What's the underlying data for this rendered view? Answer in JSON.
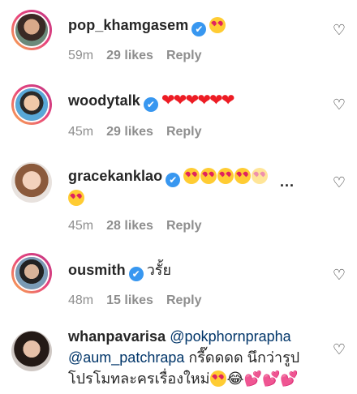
{
  "comments": [
    {
      "username": "pop_khamgasem",
      "verified_icon": "✔",
      "text": "",
      "emoji": "heart-eyes",
      "time": "59m",
      "likes": "29 likes",
      "reply": "Reply"
    },
    {
      "username": "woodytalk",
      "verified_icon": "✔",
      "hearts": "❤❤❤❤❤❤",
      "time": "45m",
      "likes": "29 likes",
      "reply": "Reply"
    },
    {
      "username": "gracekanklao",
      "verified_icon": "✔",
      "more": "...",
      "time": "45m",
      "likes": "28 likes",
      "reply": "Reply"
    },
    {
      "username": "ousmith",
      "verified_icon": "✔",
      "text": "วรั้ย",
      "time": "48m",
      "likes": "15 likes",
      "reply": "Reply"
    },
    {
      "username": "whanpavarisa",
      "mention1": "@pokphornprapha",
      "mention2": "@aum_patchrapa",
      "text1": " กรี๊ดดดด นึกว่ารูป",
      "text2": "โปรโมทละครเรื่องใหม่",
      "trailing": "😂💕💕💕"
    }
  ],
  "icons": {
    "like": "heart-outline-icon",
    "like_glyph": "♡"
  },
  "colors": {
    "verified": "#3897f0",
    "mention": "#003569",
    "meta": "#8e8e8e"
  }
}
